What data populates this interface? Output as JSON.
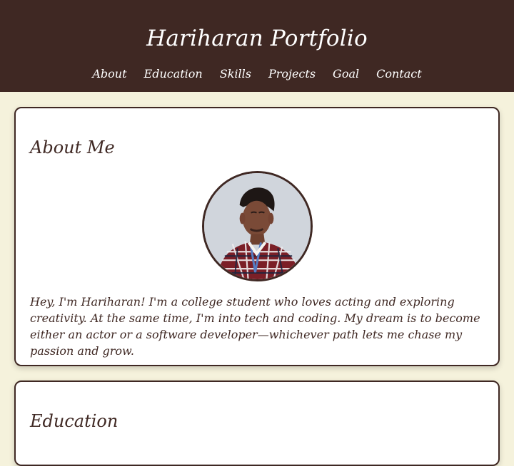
{
  "header": {
    "title": "Hariharan Portfolio",
    "nav": [
      {
        "label": "About",
        "target": "about"
      },
      {
        "label": "Education",
        "target": "education"
      },
      {
        "label": "Skills",
        "target": "skills"
      },
      {
        "label": "Projects",
        "target": "projects"
      },
      {
        "label": "Goal",
        "target": "goal"
      },
      {
        "label": "Contact",
        "target": "contact"
      }
    ]
  },
  "about": {
    "title": "About Me",
    "photo_alt": "Hariharan",
    "text": "Hey, I'm Hariharan! I'm a college student who loves acting and exploring creativity. At the same time, I'm into tech and coding. My dream is to become either an actor or a software developer—whichever path lets me chase my passion and grow."
  },
  "education": {
    "title": "Education"
  },
  "colors": {
    "header_bg": "#3f2823",
    "page_bg": "#f5f2dc",
    "card_bg": "#ffffff",
    "text": "#3f2823"
  }
}
